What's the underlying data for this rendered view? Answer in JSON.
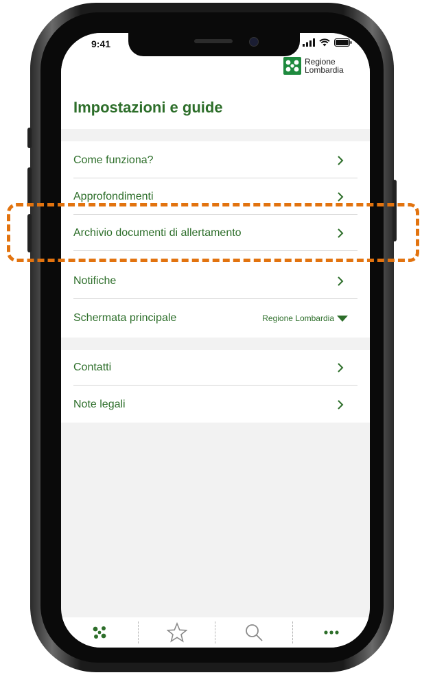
{
  "status_bar": {
    "time": "9:41"
  },
  "logo": {
    "line1": "Regione",
    "line2": "Lombardia",
    "color": "#1e8a3e"
  },
  "page_title": "Impostazioni e guide",
  "groups": [
    {
      "items": [
        {
          "label": "Come funziona?"
        },
        {
          "label": "Approfondimenti"
        },
        {
          "label": "Archivio documenti di allertamento"
        },
        {
          "label": "Notifiche"
        },
        {
          "label": "Schermata principale",
          "value": "Regione Lombardia"
        }
      ]
    },
    {
      "items": [
        {
          "label": "Contatti"
        },
        {
          "label": "Note legali"
        }
      ]
    }
  ],
  "tabs": [
    {
      "icon": "pinwheel-icon"
    },
    {
      "icon": "star-icon"
    },
    {
      "icon": "search-icon"
    },
    {
      "icon": "more-icon"
    }
  ],
  "colors": {
    "accent": "#2d6e2a",
    "highlight": "#e2730f",
    "background": "#f2f2f2"
  }
}
